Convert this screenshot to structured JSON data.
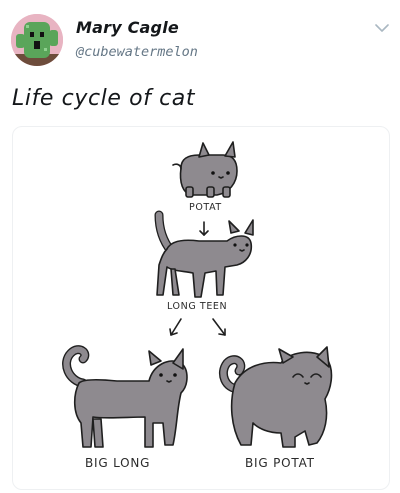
{
  "tweet": {
    "author_name": "Mary Cagle",
    "author_handle": "@cubewatermelon",
    "text": "Life cycle of cat"
  },
  "image": {
    "labels": {
      "potat": "POTAT",
      "long_teen": "LONG TEEN",
      "big_long": "BIG LONG",
      "big_potat": "BIG POTAT"
    }
  },
  "icons": {
    "menu": "chevron-down-icon",
    "avatar": "cactus-avatar"
  },
  "colors": {
    "cat_fill": "#8e8a8f",
    "outline": "#1f1f1f",
    "handle": "#657786"
  }
}
